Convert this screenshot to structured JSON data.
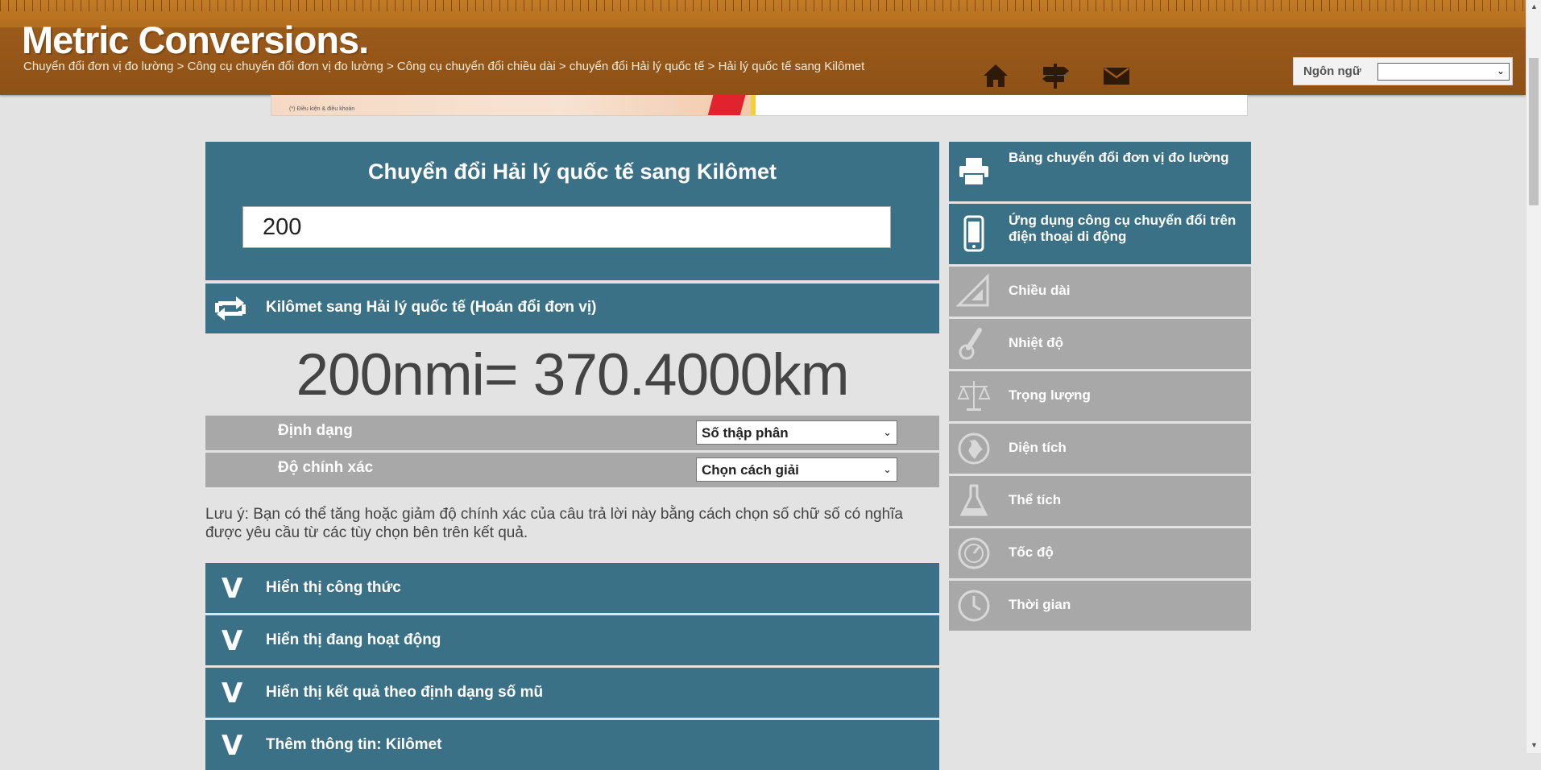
{
  "header": {
    "logo": "Metric Conversions.",
    "breadcrumb": [
      "Chuyển đổi đơn vị đo lường",
      "Công cụ chuyển đổi đơn vị đo lường",
      "Công cụ chuyển đổi chiều dài",
      "chuyển đổi Hải lý quốc tế",
      "Hải lý quốc tế sang Kilômet"
    ],
    "breadcrumb_separator": " > ",
    "icons": [
      "home-icon",
      "signpost-icon",
      "mail-icon"
    ],
    "language": {
      "label": "Ngôn ngữ",
      "value": ""
    }
  },
  "ad": {
    "fine_print": "(*) Điều kiện & điều khoản"
  },
  "converter": {
    "title": "Chuyển đổi Hải lý quốc tế sang Kilômet",
    "input_value": "200",
    "swap_label": "Kilômet sang Hải lý quốc tế (Hoán đổi đơn vị)",
    "result": "200nmi= 370.4000km",
    "format_label": "Định dạng",
    "format_value": "Số thập phân",
    "precision_label": "Độ chính xác",
    "precision_value": "Chọn cách giải",
    "note": "Lưu ý: Bạn có thể tăng hoặc giảm độ chính xác của câu trả lời này bằng cách chọn số chữ số có nghĩa được yêu cầu từ các tùy chọn bên trên kết quả.",
    "accordions": [
      {
        "icon": "V",
        "label": "Hiển thị công thức"
      },
      {
        "icon": "V",
        "label": "Hiển thị đang hoạt động"
      },
      {
        "icon": "V",
        "label": "Hiển thị kết quả theo định dạng số mũ"
      },
      {
        "icon": "V",
        "label": "Thêm thông tin: Kilômet"
      }
    ]
  },
  "sidebar": {
    "items": [
      {
        "label": "Bảng chuyển đổi đơn vị đo lường",
        "icon": "printer-icon",
        "color": "#3b7186"
      },
      {
        "label": "Ứng dụng công cụ chuyển đổi trên điện thoại di động",
        "icon": "mobile-phone-icon",
        "color": "#3b7186"
      },
      {
        "label": "Chiều dài",
        "icon": "set-square-icon",
        "color": "#a8a8a8"
      },
      {
        "label": "Nhiệt độ",
        "icon": "thermometer-icon",
        "color": "#a8a8a8"
      },
      {
        "label": "Trọng lượng",
        "icon": "scales-icon",
        "color": "#a8a8a8"
      },
      {
        "label": "Diện tích",
        "icon": "globe-icon",
        "color": "#a8a8a8"
      },
      {
        "label": "Thể tích",
        "icon": "flask-icon",
        "color": "#a8a8a8"
      },
      {
        "label": "Tốc độ",
        "icon": "speedometer-icon",
        "color": "#a8a8a8"
      },
      {
        "label": "Thời gian",
        "icon": "clock-icon",
        "color": "#a8a8a8"
      }
    ]
  },
  "colors": {
    "header_brown": "#9a5a1a",
    "panel_blue": "#3b7186",
    "panel_grey": "#a8a8a8",
    "page_bg": "#e3e3e3"
  }
}
